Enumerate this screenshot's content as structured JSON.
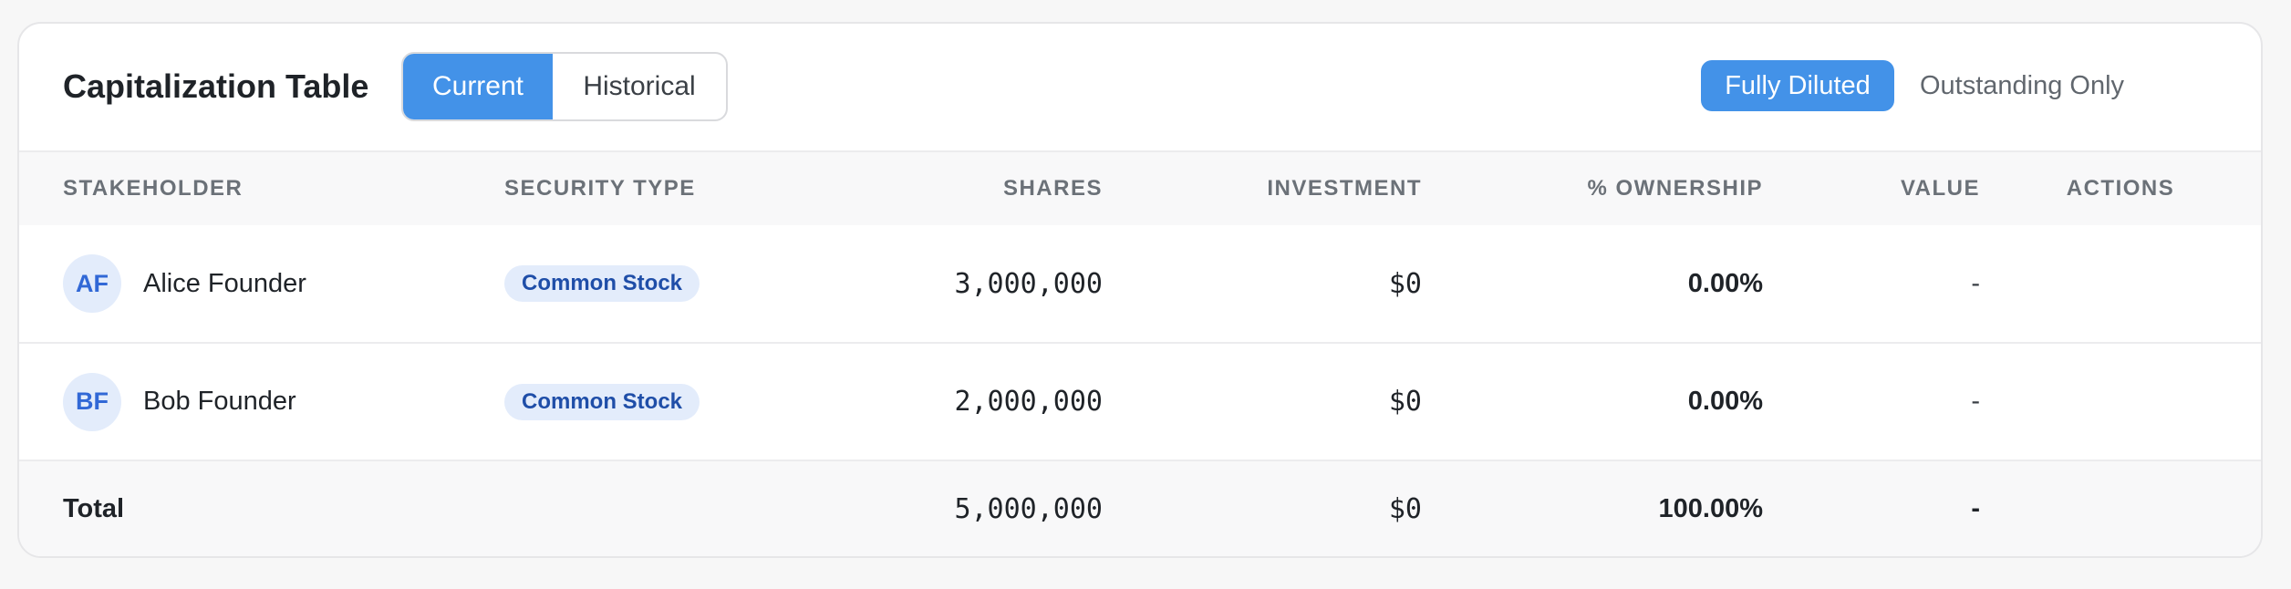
{
  "header": {
    "title": "Capitalization Table",
    "view_tabs": [
      "Current",
      "Historical"
    ],
    "dilution_options": [
      "Fully Diluted",
      "Outstanding Only"
    ]
  },
  "colors": {
    "accent": "#4392e8",
    "badge_bg": "#e3ecfb",
    "badge_text": "#1f4ea8"
  },
  "table": {
    "columns": [
      "STAKEHOLDER",
      "SECURITY TYPE",
      "SHARES",
      "INVESTMENT",
      "% OWNERSHIP",
      "VALUE",
      "ACTIONS"
    ],
    "rows": [
      {
        "initials": "AF",
        "name": "Alice Founder",
        "security_type": "Common Stock",
        "shares": "3,000,000",
        "investment": "$0",
        "ownership": "0.00%",
        "value": "-"
      },
      {
        "initials": "BF",
        "name": "Bob Founder",
        "security_type": "Common Stock",
        "shares": "2,000,000",
        "investment": "$0",
        "ownership": "0.00%",
        "value": "-"
      }
    ],
    "total": {
      "label": "Total",
      "shares": "5,000,000",
      "investment": "$0",
      "ownership": "100.00%",
      "value": "-"
    }
  }
}
